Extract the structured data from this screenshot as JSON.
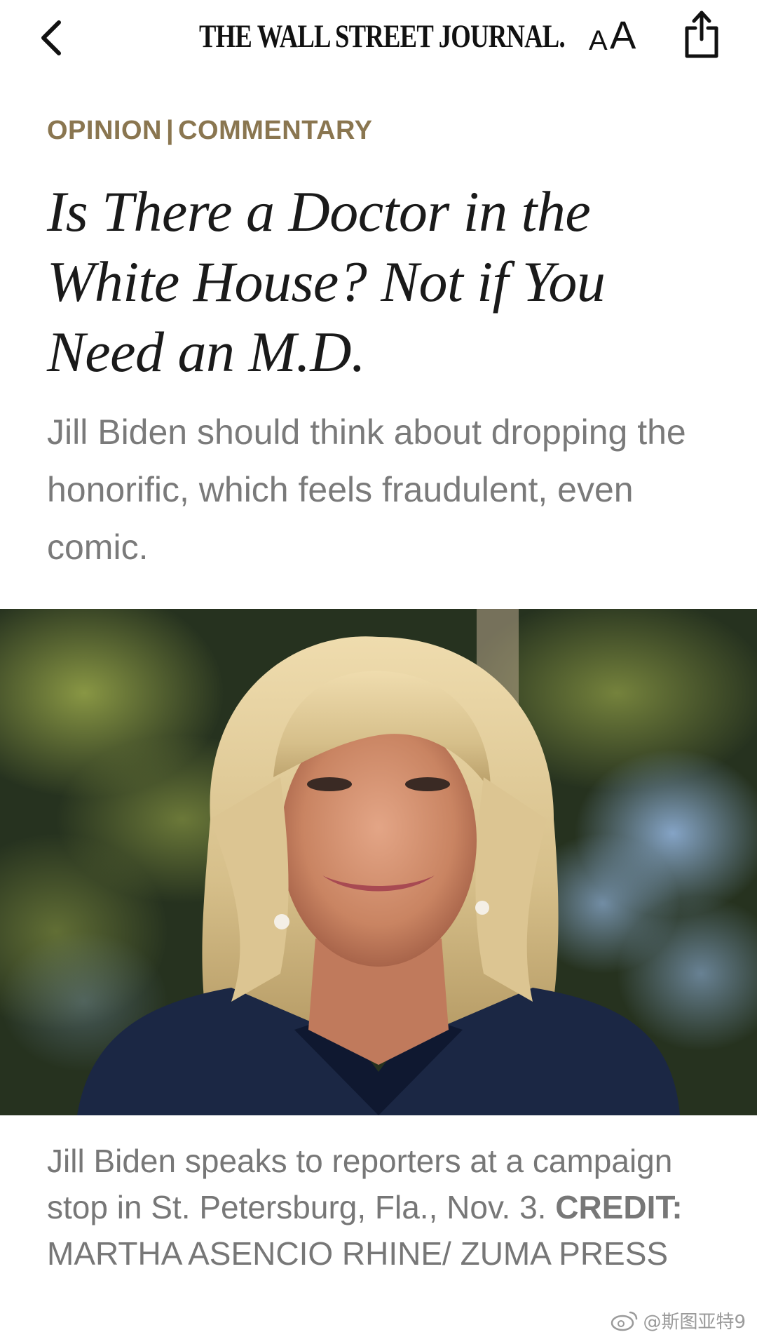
{
  "header": {
    "masthead": "THE WALL STREET JOURNAL.",
    "text_size_small": "A",
    "text_size_large": "A",
    "icons": {
      "back": "chevron-left-icon",
      "share": "share-icon"
    }
  },
  "article": {
    "section": "OPINION",
    "section_separator": "|",
    "subsection": "COMMENTARY",
    "headline": "Is There a Doctor in the White House? Not if You Need an M.D.",
    "dek": "Jill Biden should think about dropping the honorific, which feels fraudulent, even comic.",
    "caption_text": "Jill Biden speaks to reporters at a campaign stop in St. Petersburg, Fla., Nov. 3.",
    "credit_label": "CREDIT:",
    "credit_value": "MARTHA ASENCIO RHINE/ ZUMA PRESS"
  },
  "watermark": {
    "text": "@斯图亚特9",
    "icon": "weibo-icon"
  },
  "colors": {
    "kicker": "#8a7650",
    "headline": "#1a1a1a",
    "dek": "#7a7a7a",
    "caption": "#777777",
    "background": "#ffffff"
  }
}
